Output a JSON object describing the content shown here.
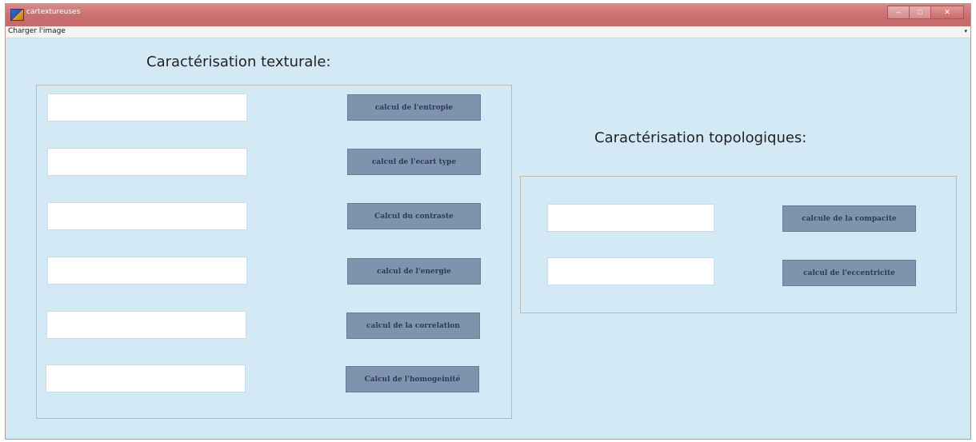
{
  "window": {
    "title": "cartextureuses",
    "controls": {
      "minimize": "–",
      "maximize": "□",
      "close": "✕"
    },
    "icon": "matlab-figure-icon"
  },
  "menubar": {
    "items": [
      {
        "label": "Charger l'image"
      }
    ],
    "overflow_icon": "▾"
  },
  "texture_section": {
    "heading": "Caractérisation texturale:",
    "rows": [
      {
        "value": "",
        "button_label": "calcul de l'entropie"
      },
      {
        "value": "",
        "button_label": "calcul de l'ecart type"
      },
      {
        "value": "",
        "button_label": "Calcul du contraste"
      },
      {
        "value": "",
        "button_label": "calcul de l'energie"
      },
      {
        "value": "",
        "button_label": "calcul de la correlation"
      },
      {
        "value": "",
        "button_label": "Calcul de l'homogeinité"
      }
    ]
  },
  "topology_section": {
    "heading": "Caractérisation topologiques:",
    "rows": [
      {
        "value": "",
        "button_label": "calcule de la compacite"
      },
      {
        "value": "",
        "button_label": "calcul de l'eccentricite"
      }
    ]
  }
}
